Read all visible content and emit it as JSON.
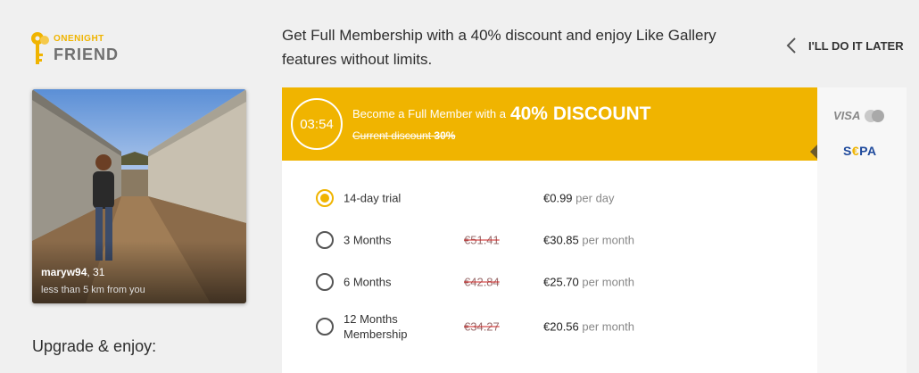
{
  "logo": {
    "line1": "ONENIGHT",
    "line2": "FRIEND"
  },
  "header": {
    "promo_text": "Get Full Membership with a 40% discount and enjoy Like Gallery features without limits.",
    "later_label": "I'LL DO IT LATER"
  },
  "profile": {
    "username": "maryw94",
    "age": ", 31",
    "distance": "less than 5 km from you"
  },
  "upgrade_label": "Upgrade & enjoy:",
  "offer": {
    "timer": "03:54",
    "headline": "Become a Full Member with a",
    "discount": "40% DISCOUNT",
    "current_label": "Current discount",
    "current_value": "30%",
    "accent_color": "#f0b400"
  },
  "plans": [
    {
      "name": "14-day trial",
      "old_price": "",
      "price": "€0.99",
      "period": "per day",
      "selected": true
    },
    {
      "name": "3 Months",
      "old_price": "€51.41",
      "price": "€30.85",
      "period": "per month",
      "selected": false
    },
    {
      "name": "6 Months",
      "old_price": "€42.84",
      "price": "€25.70",
      "period": "per month",
      "selected": false
    },
    {
      "name": "12 Months Membership",
      "old_price": "€34.27",
      "price": "€20.56",
      "period": "per month",
      "selected": false
    }
  ],
  "payment": {
    "visa": "VISA",
    "sepa_s": "S",
    "sepa_euro": "€",
    "sepa_pa": "PA"
  }
}
